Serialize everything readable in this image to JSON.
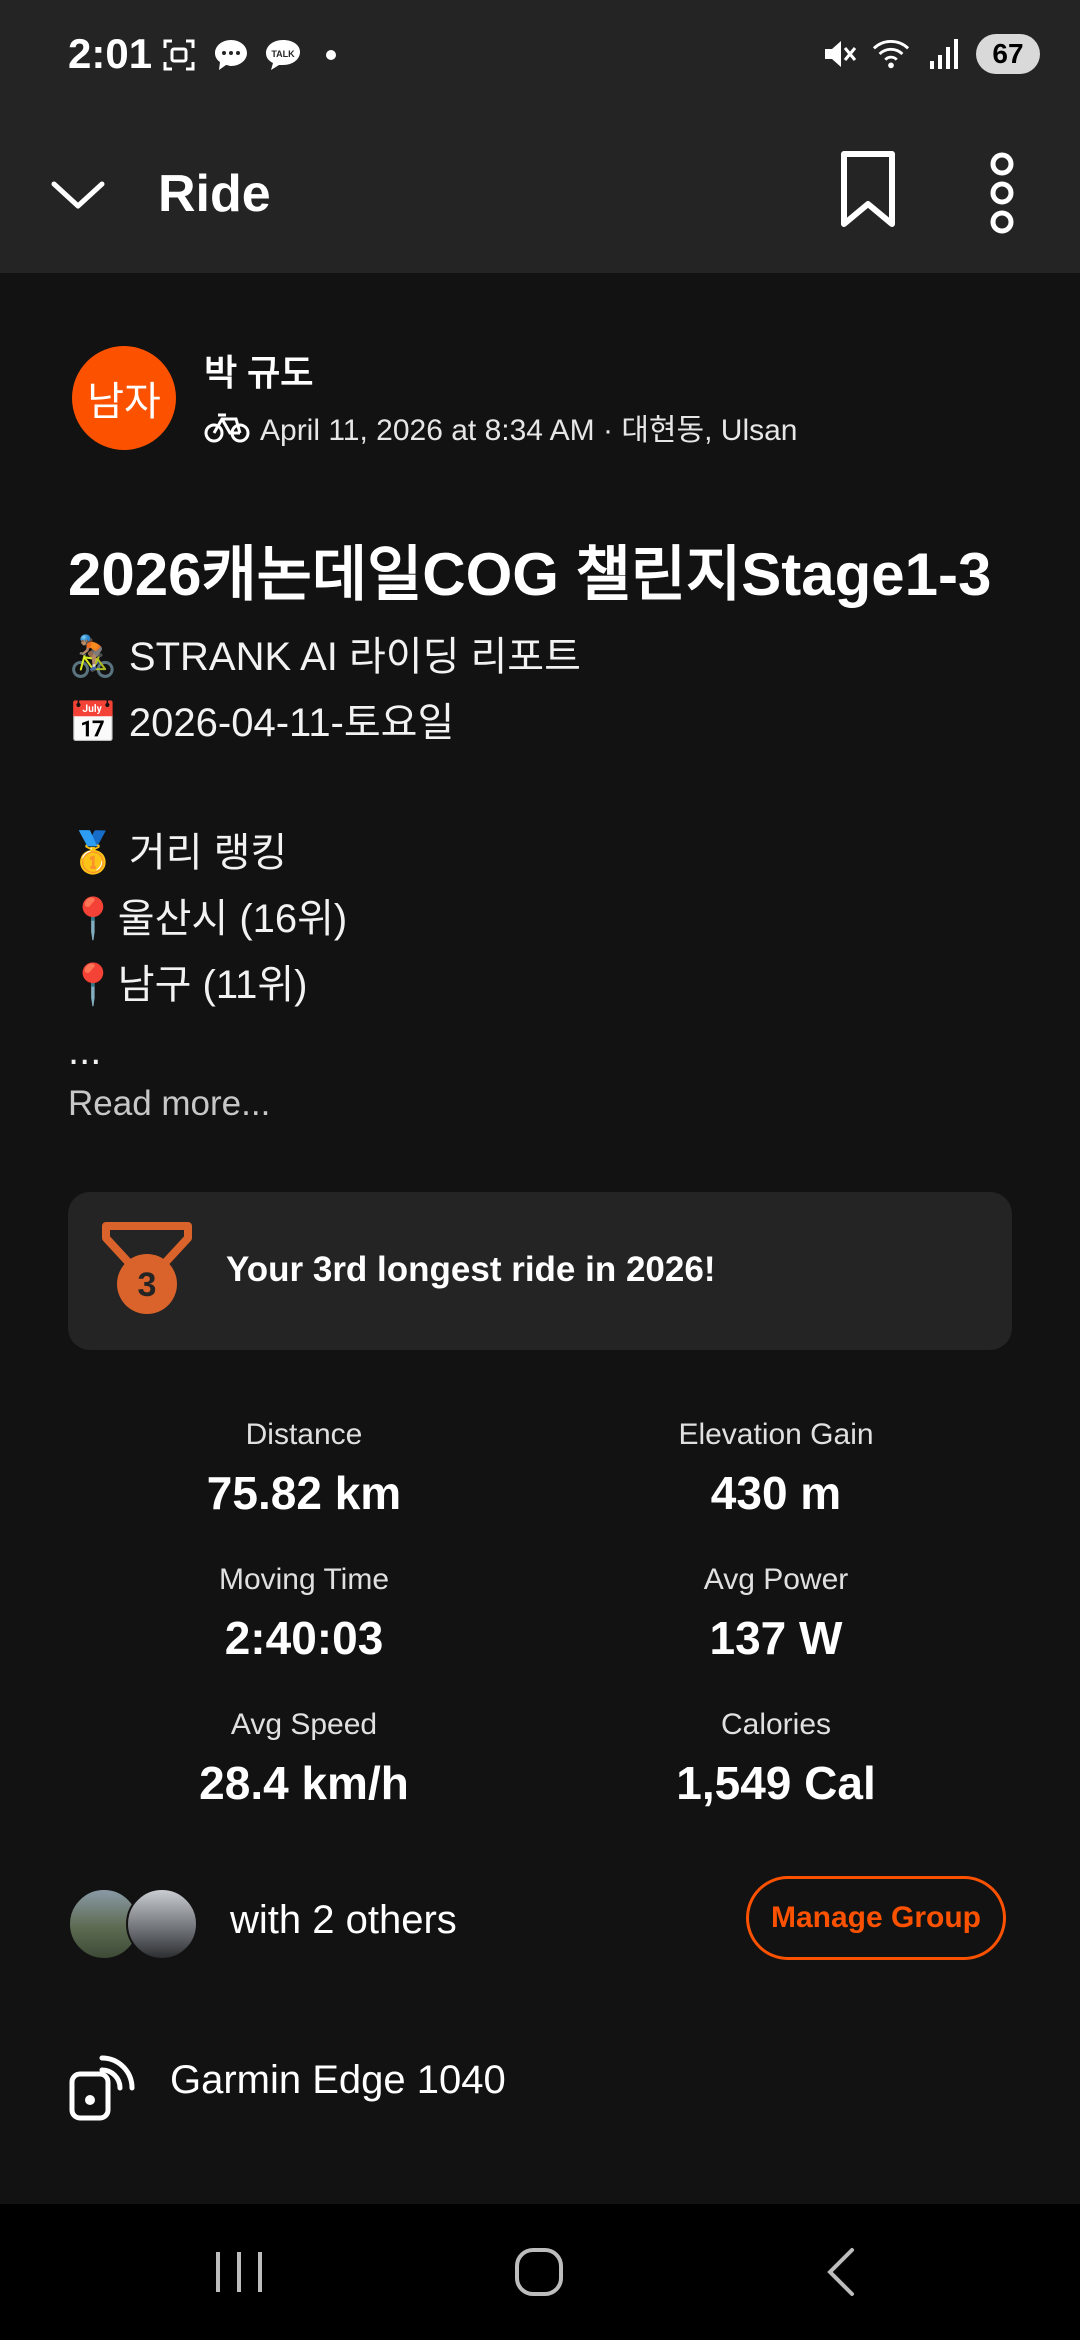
{
  "status_bar": {
    "time": "2:01",
    "battery": "67"
  },
  "app_bar": {
    "title": "Ride"
  },
  "author": {
    "avatar_text": "남자",
    "name": "박 규도",
    "meta": "April 11, 2026 at 8:34 AM · 대현동, Ulsan"
  },
  "activity": {
    "title": "2026캐논데일COG 챌린지Stage1-3",
    "description": [
      "🚴🏽 STRANK AI 라이딩 리포트",
      "📅 2026-04-11-토요일",
      "",
      "🥇 거리 랭킹",
      "📍울산시 (16위)",
      "📍남구 (11위)",
      "..."
    ],
    "read_more": "Read more..."
  },
  "achievement": {
    "text": "Your 3rd longest ride in 2026!",
    "rank": "3"
  },
  "stats": [
    {
      "label": "Distance",
      "value": "75.82 km"
    },
    {
      "label": "Elevation Gain",
      "value": "430 m"
    },
    {
      "label": "Moving Time",
      "value": "2:40:03"
    },
    {
      "label": "Avg Power",
      "value": "137 W"
    },
    {
      "label": "Avg Speed",
      "value": "28.4 km/h"
    },
    {
      "label": "Calories",
      "value": "1,549 Cal"
    }
  ],
  "group": {
    "text": "with 2 others",
    "button": "Manage Group"
  },
  "device": {
    "name": "Garmin Edge 1040"
  },
  "colors": {
    "accent": "#fc5200",
    "background": "#121212",
    "card": "#242424"
  }
}
